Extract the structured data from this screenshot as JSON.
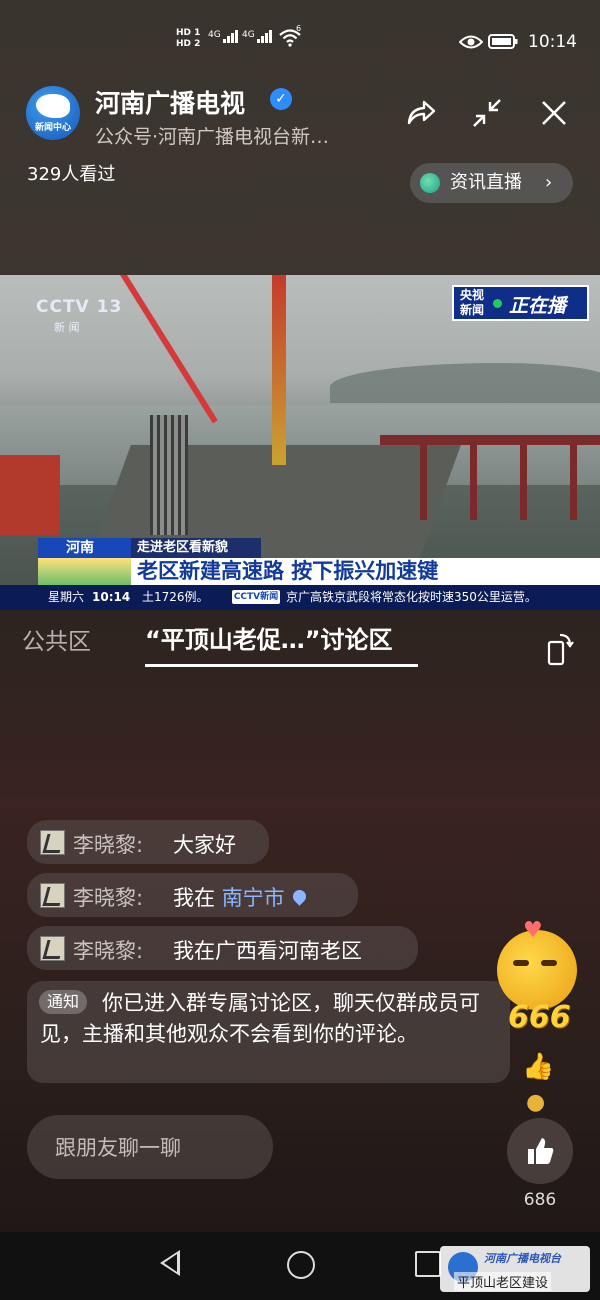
{
  "status_bar": {
    "hd1": "HD 1",
    "hd2": "HD 2",
    "net1": "4G",
    "net2": "4G",
    "wifi_num": "6",
    "time": "10:14"
  },
  "header": {
    "channel_name": "河南广播电视",
    "subtitle": "公众号·河南广播电视台新…",
    "logo_text": "新闻中心",
    "viewers": "329人看过",
    "live_chip": "资讯直播"
  },
  "video": {
    "cctv_logo": "CCTV 13",
    "cctv_sub": "新 闻",
    "onair_small": "央视\n新闻",
    "onair_big": "正在播",
    "ticker_province": "河南",
    "ticker_section": "走进老区看新貌",
    "ticker_headline": "老区新建高速路 按下振兴加速键",
    "ticker_day": "星期六",
    "ticker_time": "10:14",
    "ticker_news1": "土1726例。",
    "ticker_logo": "CCTV新闻",
    "ticker_news2": "京广高铁京武段将常态化按时速350公里运营。"
  },
  "tabs": {
    "public": "公共区",
    "discussion": "“平顶山老促…”讨论区"
  },
  "chat": {
    "messages": [
      {
        "name": "李晓黎:",
        "text": "大家好"
      },
      {
        "name": "李晓黎:",
        "text_prefix": "我在",
        "city": "南宁市"
      },
      {
        "name": "李晓黎:",
        "text": "我在广西看河南老区"
      }
    ],
    "notice_tag": "通知",
    "notice_text": "你已进入群专属讨论区，聊天仅群成员可见，主播和其他观众不会看到你的评论。"
  },
  "bottom": {
    "input_placeholder": "跟朋友聊一聊",
    "like_count": "686",
    "reaction_number": "666"
  },
  "watermark": {
    "title": "河南广播电视台",
    "subtitle": "平顶山老区建设"
  }
}
